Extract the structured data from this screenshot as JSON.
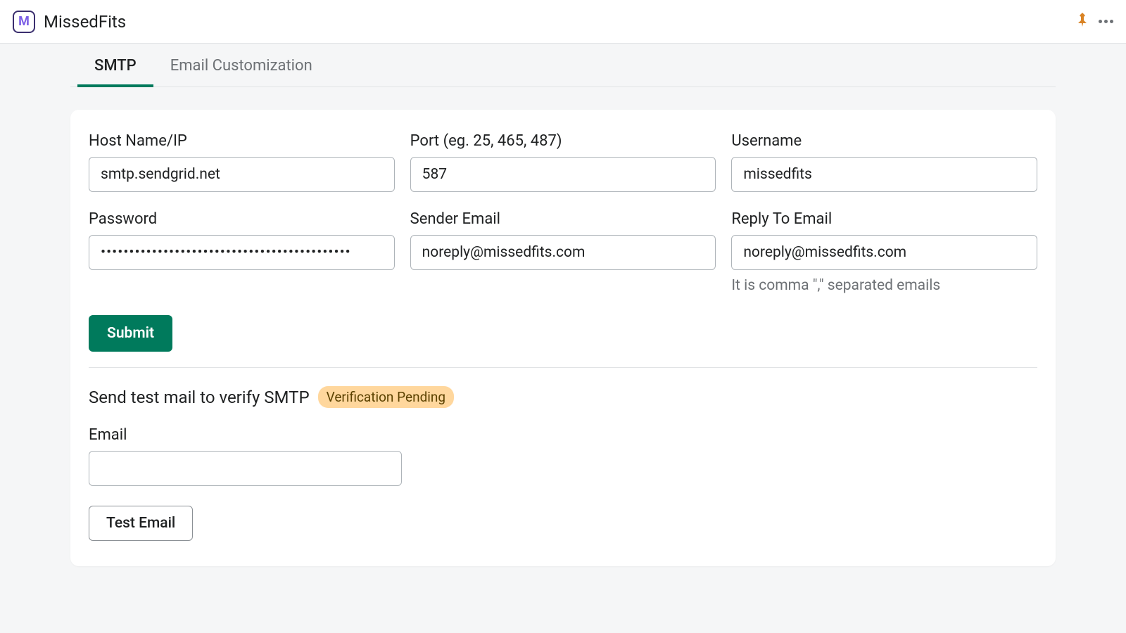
{
  "header": {
    "app_title": "MissedFits",
    "logo_letter": "M"
  },
  "tabs": [
    {
      "label": "SMTP",
      "active": true
    },
    {
      "label": "Email Customization",
      "active": false
    }
  ],
  "form": {
    "host": {
      "label": "Host Name/IP",
      "value": "smtp.sendgrid.net"
    },
    "port": {
      "label": "Port (eg. 25, 465, 487)",
      "value": "587"
    },
    "username": {
      "label": "Username",
      "value": "missedfits"
    },
    "password": {
      "label": "Password",
      "value": "••••••••••••••••••••••••••••••••••••••••••••"
    },
    "sender_email": {
      "label": "Sender Email",
      "value": "noreply@missedfits.com"
    },
    "reply_to": {
      "label": "Reply To Email",
      "value": "noreply@missedfits.com",
      "help": "It is comma \",\" separated emails"
    },
    "submit_label": "Submit"
  },
  "test": {
    "heading": "Send test mail to verify SMTP",
    "badge": "Verification Pending",
    "email_label": "Email",
    "email_value": "",
    "button_label": "Test Email"
  }
}
